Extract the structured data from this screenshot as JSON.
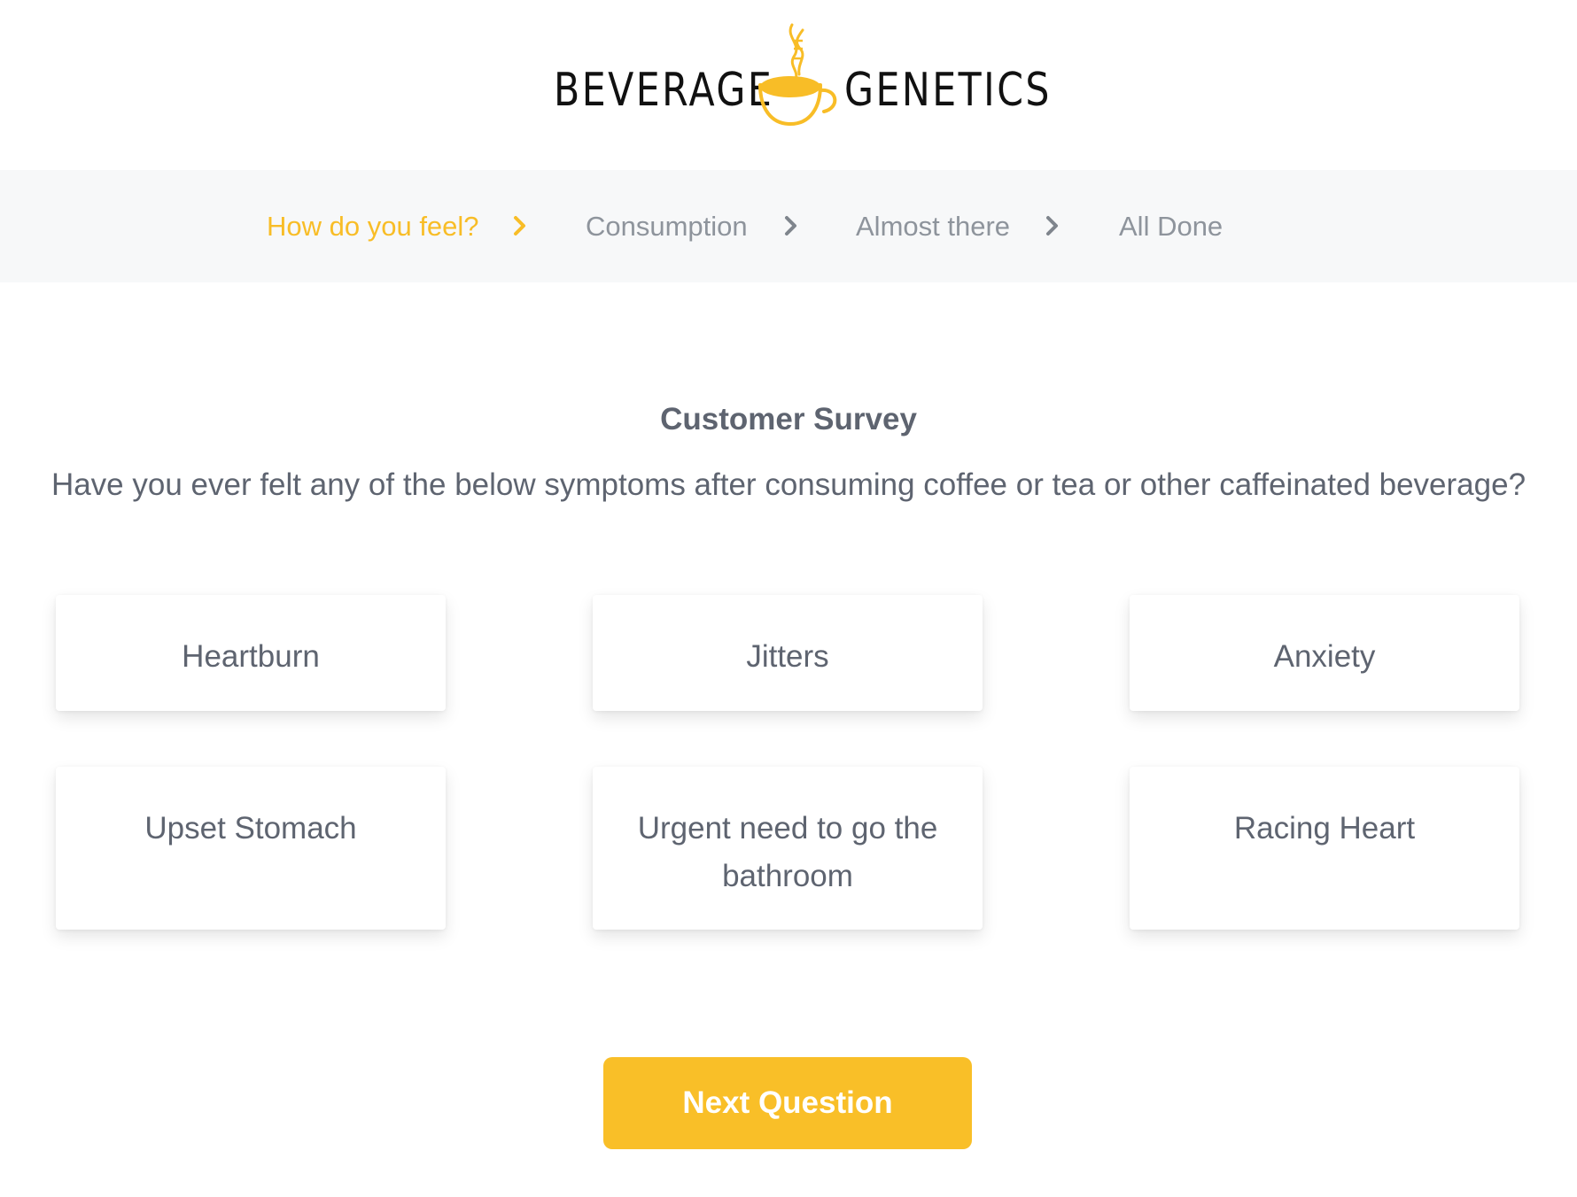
{
  "header": {
    "logo_left": "BEVERAGE",
    "logo_right": "GENETICS",
    "logo_icon": "coffee-cup-dna-icon"
  },
  "stepper": {
    "steps": [
      {
        "label": "How do you feel?",
        "active": true
      },
      {
        "label": "Consumption",
        "active": false
      },
      {
        "label": "Almost there",
        "active": false
      },
      {
        "label": "All Done",
        "active": false
      }
    ],
    "separator_icon": "chevron-right-icon"
  },
  "survey": {
    "title": "Customer Survey",
    "question": "Have you ever felt any of the below symptoms after consuming coffee or tea or other caffeinated beverage?",
    "options": [
      "Heartburn",
      "Jitters",
      "Anxiety",
      "Upset Stomach",
      "Urgent need to go the bathroom",
      "Racing Heart"
    ]
  },
  "actions": {
    "next_label": "Next Question"
  },
  "colors": {
    "accent": "#f9bf28",
    "active_step": "#f8bd27",
    "inactive_step": "#8e949c",
    "text": "#5e6470",
    "stepper_bg": "#f7f8f9"
  }
}
